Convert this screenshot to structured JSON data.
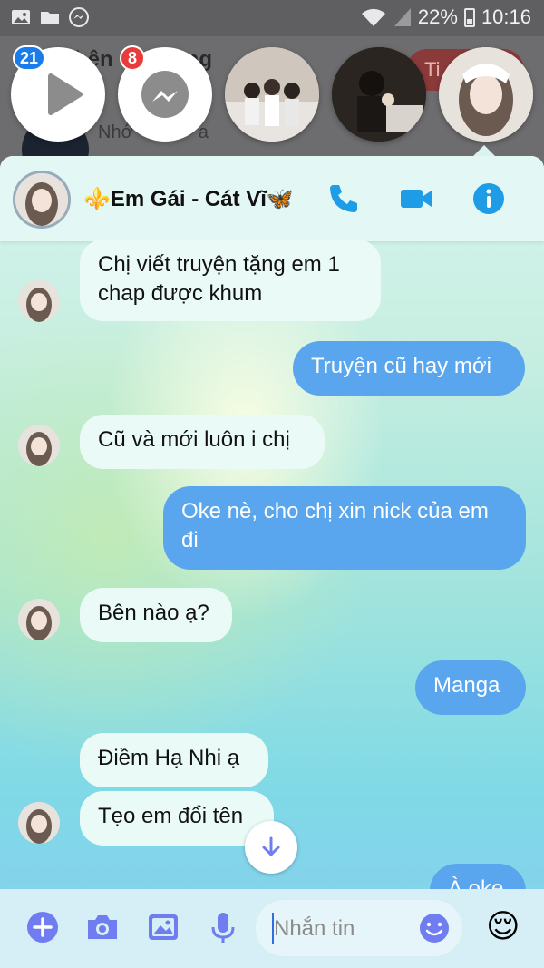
{
  "status_bar": {
    "battery": "22%",
    "time": "10:16"
  },
  "background_page": {
    "title_fragment": "hên",
    "title_fragment2": "ng",
    "subtitle": "Nhớ",
    "subtitle2": "a",
    "pill_label": "Ti"
  },
  "chat_heads": [
    {
      "name": "video-head",
      "badge": "21",
      "badge_color": "#1a7bea"
    },
    {
      "name": "messenger-head",
      "badge": "8",
      "badge_color": "#ea3b3b"
    }
  ],
  "header": {
    "title": "⚜️Em Gái - Cát Vĩ🦋"
  },
  "messages": [
    {
      "side": "in",
      "text": "Chị viết truyện tặng em 1 chap được khum"
    },
    {
      "side": "out",
      "text": "Truyện cũ hay mới"
    },
    {
      "side": "in",
      "text": "Cũ và mới luôn i chị"
    },
    {
      "side": "out",
      "text": "Oke nè, cho chị xin nick của em đi"
    },
    {
      "side": "in",
      "text": "Bên nào ạ?"
    },
    {
      "side": "out",
      "text": "Manga"
    },
    {
      "side": "in",
      "text": "Điềm Hạ Nhi ạ"
    },
    {
      "side": "in",
      "text": "Tẹo em đổi tên"
    },
    {
      "side": "out",
      "text": "À oke"
    }
  ],
  "composer": {
    "placeholder": "Nhắn tin",
    "emoji": "😌"
  },
  "colors": {
    "accent": "#1f9ce6",
    "outgoing_bubble": "#5aa6ee",
    "incoming_bubble": "#eafaf7",
    "composer_icons": "#6f7df0"
  }
}
